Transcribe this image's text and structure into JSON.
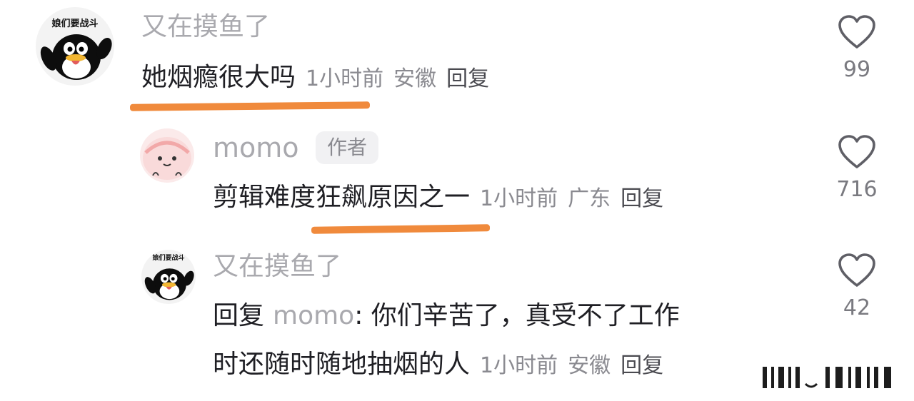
{
  "comments": [
    {
      "avatar_caption": "娘们要战斗",
      "username": "又在摸鱼了",
      "text": "她烟瘾很大吗",
      "time": "1小时前",
      "location": "安徽",
      "reply_label": "回复",
      "like_count": "99"
    },
    {
      "username": "momo",
      "author_badge": "作者",
      "text": "剪辑难度狂飙原因之一",
      "time": "1小时前",
      "location": "广东",
      "reply_label": "回复",
      "like_count": "716"
    },
    {
      "avatar_caption": "娘们要战斗",
      "username": "又在摸鱼了",
      "reply_prefix": "回复",
      "reply_target": "momo",
      "text_line1": ": 你们辛苦了，真受不了工作",
      "text_line2": "时还随时随地抽烟的人",
      "time": "1小时前",
      "location": "安徽",
      "reply_label": "回复",
      "like_count": "42"
    }
  ],
  "highlight_color": "#f08a3c"
}
